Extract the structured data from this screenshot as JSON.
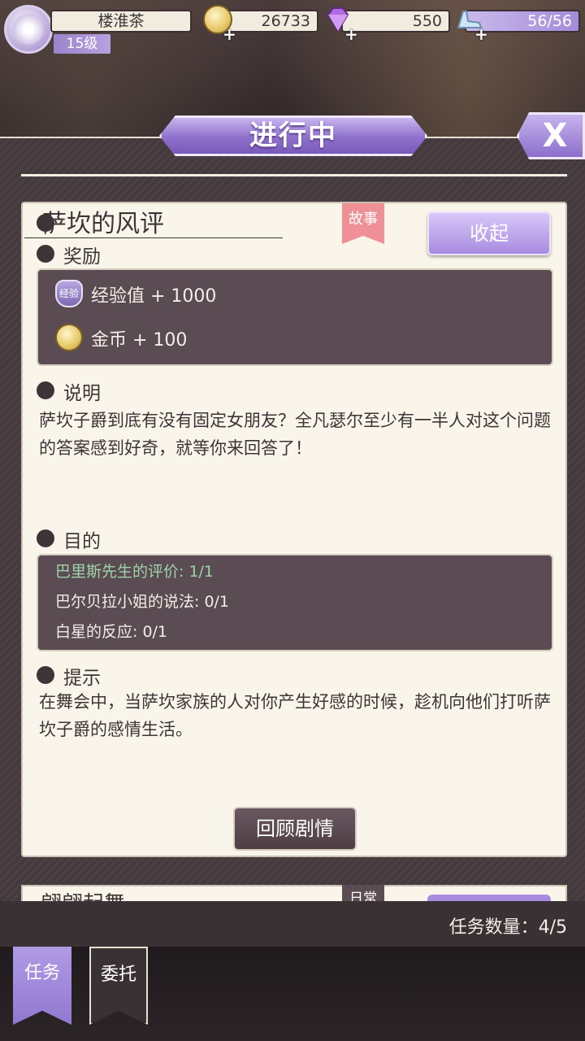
{
  "player": {
    "name": "楼淮茶",
    "level": "15级"
  },
  "resources": {
    "gold": "26733",
    "gems": "550",
    "energy": "56/56"
  },
  "panel": {
    "title": "进行中",
    "close_label": "X"
  },
  "quest": {
    "title": "萨坎的风评",
    "tag": "故事",
    "collapse_label": "收起",
    "reward_label": "奖励",
    "rewards": [
      {
        "icon_text": "经验",
        "text": "经验值 + 1000"
      },
      {
        "text": "金币 + 100"
      }
    ],
    "desc_label": "说明",
    "description": "萨坎子爵到底有没有固定女朋友？全凡瑟尔至少有一半人对这个问题的答案感到好奇，就等你来回答了！",
    "objective_label": "目的",
    "objectives": [
      {
        "text": "巴里斯先生的评价: 1/1",
        "done": true
      },
      {
        "text": "巴尔贝拉小姐的说法: 0/1",
        "done": false
      },
      {
        "text": "白星的反应: 0/1",
        "done": false
      }
    ],
    "hint_label": "提示",
    "hint": "在舞会中，当萨坎家族的人对你产生好感的时候，趁机向他们打听萨坎子爵的感情生活。",
    "review_label": "回顾剧情"
  },
  "next_quest": {
    "title": "翩翩起舞",
    "tag": "日常"
  },
  "task_count": "任务数量：4/5",
  "tabs": {
    "tasks": "任务",
    "commission": "委托"
  },
  "colors": {
    "accent": "#9b84c9",
    "panel": "#4a4044",
    "card": "#f9f5ea",
    "box": "#5b4b52",
    "tag": "#ef8f96"
  }
}
